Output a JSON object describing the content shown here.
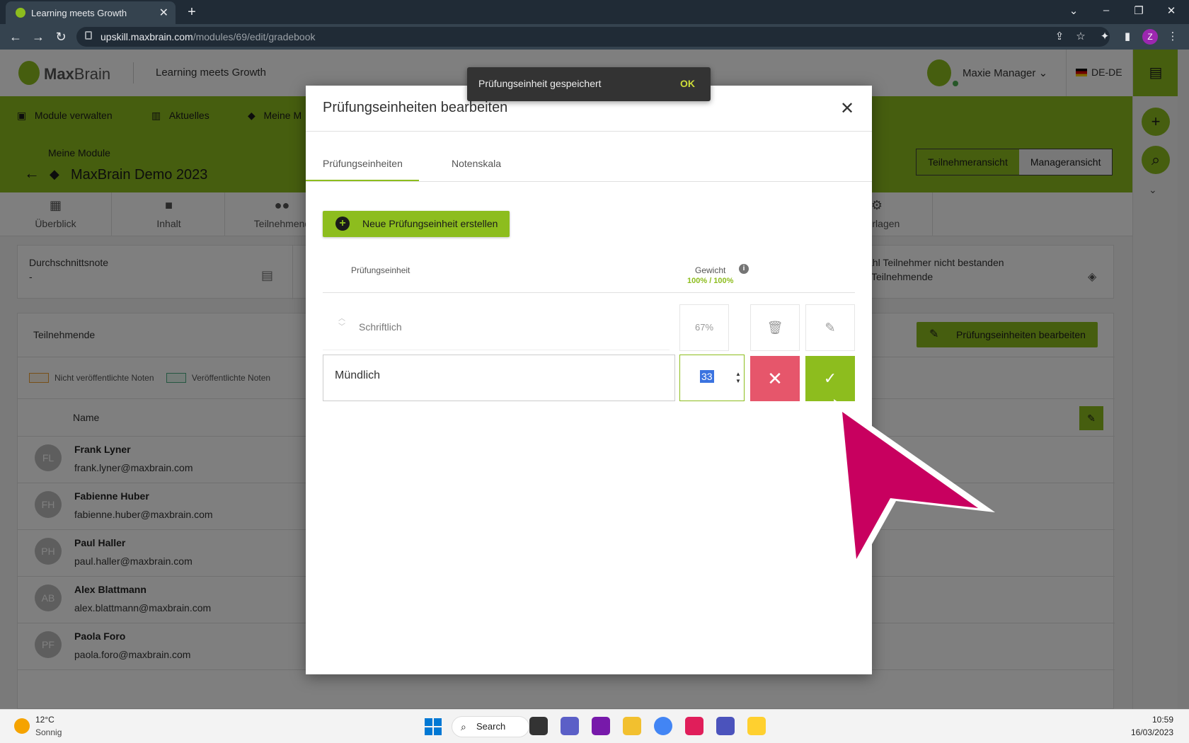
{
  "browser": {
    "tab_title": "Learning meets Growth",
    "url_host": "upskill.maxbrain.com",
    "url_path": "/modules/69/edit/gradebook",
    "profile_initial": "Z"
  },
  "app": {
    "logo_bold": "Max",
    "logo_light": "Brain",
    "tagline": "Learning meets Growth",
    "user_name": "Maxie Manager",
    "language": "DE-DE",
    "nav": [
      "Module verwalten",
      "Aktuelles",
      "Meine M"
    ],
    "breadcrumb": "Meine Module",
    "module_title": "MaxBrain Demo 2023",
    "views": [
      "Teilnehmeransicht",
      "Manageransicht"
    ],
    "subnav": [
      "Überblick",
      "Inhalt",
      "Teilnehmend",
      "tsvorlagen"
    ],
    "stats": {
      "avg_label": "Durchschnittsnote",
      "avg_value": "-",
      "failed_label": "ahl Teilnehmer nicht bestanden",
      "failed_value": "Teilnehmende"
    },
    "participants": {
      "title": "Teilnehmende",
      "edit_units_label": "Prüfungseinheiten bearbeiten",
      "legend_unpublished": "Nicht veröffentlichte Noten",
      "legend_published": "Veröffentlichte Noten",
      "name_header": "Name",
      "rows": [
        {
          "initials": "FL",
          "name": "Frank Lyner",
          "email": "frank.lyner@maxbrain.com"
        },
        {
          "initials": "FH",
          "name": "Fabienne Huber",
          "email": "fabienne.huber@maxbrain.com"
        },
        {
          "initials": "PH",
          "name": "Paul Haller",
          "email": "paul.haller@maxbrain.com"
        },
        {
          "initials": "AB",
          "name": "Alex Blattmann",
          "email": "alex.blattmann@maxbrain.com"
        },
        {
          "initials": "PF",
          "name": "Paola Foro",
          "email": "paola.foro@maxbrain.com"
        }
      ]
    }
  },
  "modal": {
    "title": "Prüfungseinheiten bearbeiten",
    "tabs": [
      "Prüfungseinheiten",
      "Notenskala"
    ],
    "new_unit_label": "Neue Prüfungseinheit erstellen",
    "col_unit": "Prüfungseinheit",
    "col_weight": "Gewicht",
    "weight_total": "100% / 100%",
    "units": [
      {
        "name": "Schriftlich",
        "weight": "67%"
      }
    ],
    "editing": {
      "name": "Mündlich",
      "weight": "33"
    }
  },
  "snackbar": {
    "message": "Prüfungseinheit gespeichert",
    "action": "OK"
  },
  "taskbar": {
    "temp": "12°C",
    "weather": "Sonnig",
    "search_label": "Search",
    "time": "10:59",
    "date": "16/03/2023"
  },
  "colors": {
    "brand_green": "#8dbd1e",
    "cancel_red": "#e6566b",
    "pointer_magenta": "#c8005f"
  }
}
